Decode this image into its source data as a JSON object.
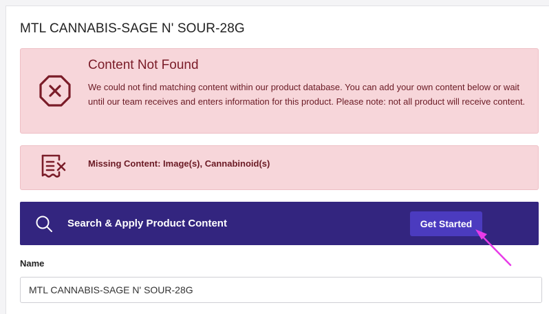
{
  "product": {
    "title": "MTL CANNABIS-SAGE N' SOUR-28G"
  },
  "alerts": {
    "not_found": {
      "icon": "error-octagon-icon",
      "heading": "Content Not Found",
      "body": "We could not find matching content within our product database. You can add your own content below or wait until our team receives and enters information for this product. Please note: not all product will receive content."
    },
    "missing": {
      "icon": "missing-receipt-icon",
      "text": "Missing Content: Image(s), Cannabinoid(s)"
    }
  },
  "search_bar": {
    "icon": "search-icon",
    "label": "Search & Apply Product Content",
    "button_label": "Get Started"
  },
  "form": {
    "name_label": "Name",
    "name_value": "MTL CANNABIS-SAGE N' SOUR-28G"
  },
  "colors": {
    "alert_bg": "#f7d6da",
    "alert_text": "#7a1c28",
    "search_bar_bg": "#33257f",
    "button_bg": "#4b3bbf",
    "annotation_arrow": "#e83be8"
  }
}
